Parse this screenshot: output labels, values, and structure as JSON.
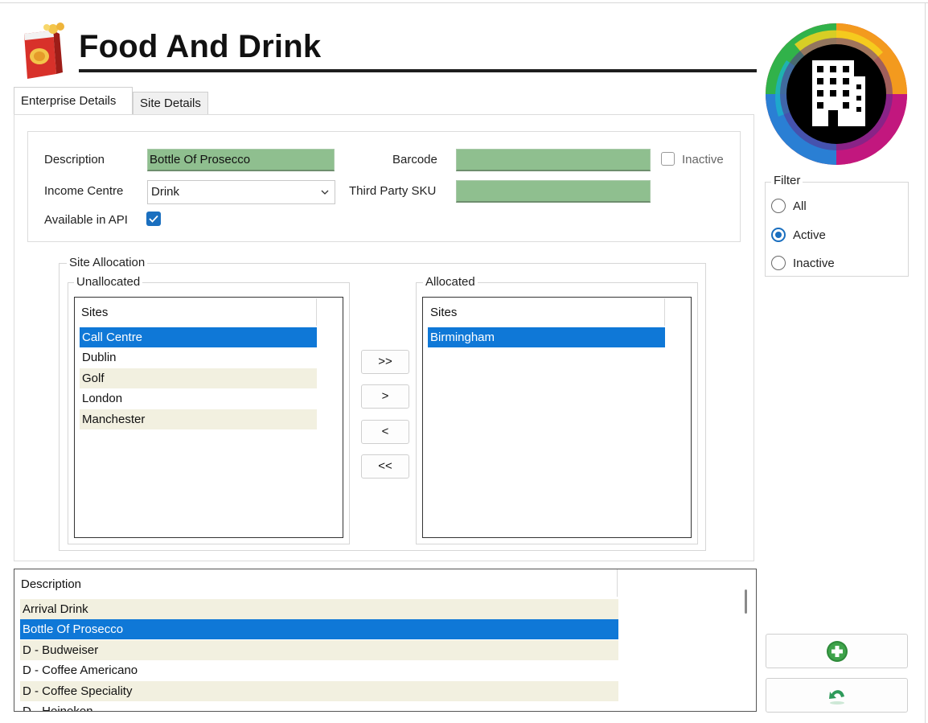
{
  "header": {
    "title": "Food And Drink",
    "logo_icon": "snack-bag-icon",
    "brand_icon": "building-icon"
  },
  "tabs": [
    {
      "label": "Enterprise Details",
      "active": true
    },
    {
      "label": "Site Details",
      "active": false
    }
  ],
  "details": {
    "description_label": "Description",
    "description_value": "Bottle Of Prosecco",
    "barcode_label": "Barcode",
    "barcode_value": "",
    "inactive_label": "Inactive",
    "inactive_checked": false,
    "income_centre_label": "Income Centre",
    "income_centre_value": "Drink",
    "third_party_sku_label": "Third Party SKU",
    "third_party_sku_value": "",
    "available_api_label": "Available in API",
    "available_api_checked": true
  },
  "site_allocation": {
    "title": "Site Allocation",
    "unallocated": {
      "title": "Unallocated",
      "column": "Sites",
      "items": [
        "Call Centre",
        "Dublin",
        "Golf",
        "London",
        "Manchester"
      ],
      "selected": "Call Centre"
    },
    "allocated": {
      "title": "Allocated",
      "column": "Sites",
      "items": [
        "Birmingham"
      ],
      "selected": "Birmingham"
    },
    "buttons": {
      "add_all": ">>",
      "add": ">",
      "remove": "<",
      "remove_all": "<<"
    }
  },
  "filter": {
    "title": "Filter",
    "options": [
      "All",
      "Active",
      "Inactive"
    ],
    "selected": "Active"
  },
  "grid": {
    "column": "Description",
    "rows": [
      "Arrival Drink",
      "Bottle Of Prosecco",
      "D - Budweiser",
      "D - Coffee Americano",
      "D - Coffee Speciality",
      "D - Heineken"
    ],
    "selected": "Bottle Of Prosecco"
  },
  "actions": {
    "add_icon": "plus-circle-icon",
    "undo_icon": "undo-arrow-icon"
  },
  "colors": {
    "selection": "#0f78d7",
    "field_green": "#8fbf8f",
    "alt_row": "#f2f0e0",
    "accent": "#1a6fbf"
  }
}
